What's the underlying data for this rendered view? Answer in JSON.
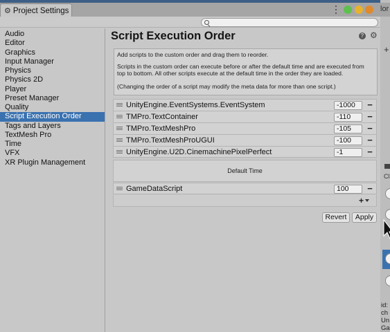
{
  "window": {
    "tab_title": "Project Settings"
  },
  "search": {
    "placeholder": ""
  },
  "sidebar": {
    "items": [
      {
        "label": "Audio"
      },
      {
        "label": "Editor"
      },
      {
        "label": "Graphics"
      },
      {
        "label": "Input Manager"
      },
      {
        "label": "Physics"
      },
      {
        "label": "Physics 2D"
      },
      {
        "label": "Player"
      },
      {
        "label": "Preset Manager"
      },
      {
        "label": "Quality"
      },
      {
        "label": "Script Execution Order",
        "selected": true
      },
      {
        "label": "Tags and Layers"
      },
      {
        "label": "TextMesh Pro"
      },
      {
        "label": "Time"
      },
      {
        "label": "VFX"
      },
      {
        "label": "XR Plugin Management"
      }
    ]
  },
  "main": {
    "title": "Script Execution Order",
    "info": {
      "line1": "Add scripts to the custom order and drag them to reorder.",
      "line2": "Scripts in the custom order can execute before or after the default time and are executed from top to bottom. All other scripts execute at the default time in the order they are loaded.",
      "line3": "(Changing the order of a script may modify the meta data for more than one script.)"
    },
    "scripts_before": [
      {
        "name": "UnityEngine.EventSystems.EventSystem",
        "order": "-1000"
      },
      {
        "name": "TMPro.TextContainer",
        "order": "-110"
      },
      {
        "name": "TMPro.TextMeshPro",
        "order": "-105"
      },
      {
        "name": "TMPro.TextMeshProUGUI",
        "order": "-100"
      },
      {
        "name": "UnityEngine.U2D.CinemachinePixelPerfect",
        "order": "-1"
      }
    ],
    "default_time_label": "Default Time",
    "scripts_after": [
      {
        "name": "GameDataScript",
        "order": "100"
      }
    ],
    "add_label": "+",
    "remove_label": "−",
    "revert_label": "Revert",
    "apply_label": "Apply"
  },
  "background_panel": {
    "top_text": "lor",
    "ch_text": "Cl",
    "bottom_text": "id:\nch\nUn\nGa"
  },
  "colors": {
    "selection": "#3a72b0",
    "menubar": "#3d5f86",
    "traffic_green": "#5fbf4f",
    "traffic_yellow": "#e7b32e",
    "traffic_orange": "#e08a2e"
  }
}
